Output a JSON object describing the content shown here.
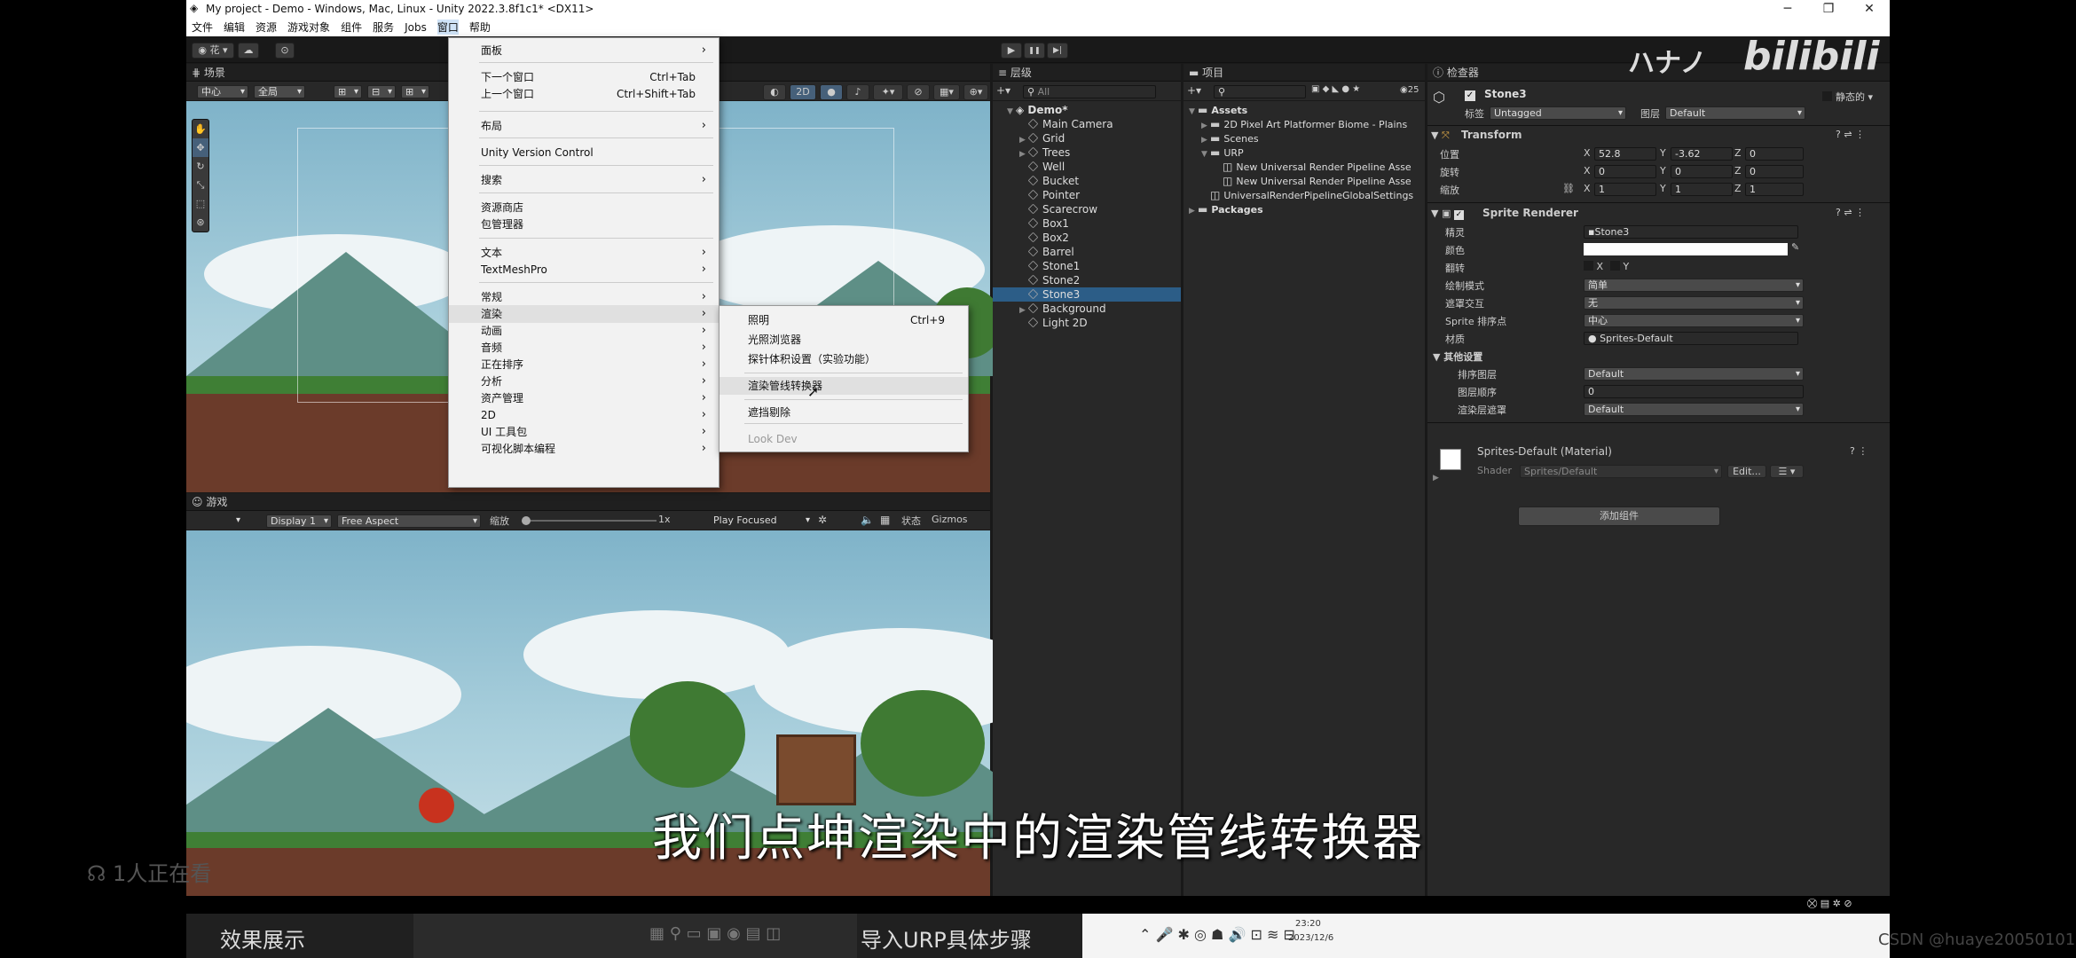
{
  "window": {
    "title": "My project - Demo - Windows, Mac, Linux - Unity 2022.3.8f1c1* <DX11>",
    "min": "─",
    "max": "❐",
    "close": "✕"
  },
  "menubar": [
    "文件",
    "编辑",
    "资源",
    "游戏对象",
    "组件",
    "服务",
    "Jobs",
    "窗口",
    "帮助"
  ],
  "toolbar": {
    "account": "花",
    "play": "▶",
    "pause": "❚❚",
    "step": "▶|"
  },
  "watermark": {
    "brand": "bilibili",
    "text": "ハナノ"
  },
  "window_menu": {
    "items": [
      {
        "label": "面板",
        "shortcut": "",
        "arrow": "›"
      },
      {
        "label": "下一个窗口",
        "shortcut": "Ctrl+Tab",
        "arrow": ""
      },
      {
        "label": "上一个窗口",
        "shortcut": "Ctrl+Shift+Tab",
        "arrow": ""
      },
      {
        "label": "布局",
        "shortcut": "",
        "arrow": "›"
      },
      {
        "label": "Unity Version Control",
        "shortcut": "",
        "arrow": ""
      },
      {
        "label": "搜索",
        "shortcut": "",
        "arrow": "›"
      },
      {
        "label": "资源商店",
        "shortcut": "",
        "arrow": ""
      },
      {
        "label": "包管理器",
        "shortcut": "",
        "arrow": ""
      },
      {
        "label": "文本",
        "shortcut": "",
        "arrow": "›"
      },
      {
        "label": "TextMeshPro",
        "shortcut": "",
        "arrow": "›"
      },
      {
        "label": "常规",
        "shortcut": "",
        "arrow": "›"
      },
      {
        "label": "渲染",
        "shortcut": "",
        "arrow": "›"
      },
      {
        "label": "动画",
        "shortcut": "",
        "arrow": "›"
      },
      {
        "label": "音频",
        "shortcut": "",
        "arrow": "›"
      },
      {
        "label": "正在排序",
        "shortcut": "",
        "arrow": "›"
      },
      {
        "label": "分析",
        "shortcut": "",
        "arrow": "›"
      },
      {
        "label": "资产管理",
        "shortcut": "",
        "arrow": "›"
      },
      {
        "label": "2D",
        "shortcut": "",
        "arrow": "›"
      },
      {
        "label": "UI 工具包",
        "shortcut": "",
        "arrow": "›"
      },
      {
        "label": "可视化脚本编程",
        "shortcut": "",
        "arrow": "›"
      }
    ]
  },
  "render_submenu": {
    "items": [
      {
        "label": "照明",
        "shortcut": "Ctrl+9"
      },
      {
        "label": "光照浏览器",
        "shortcut": ""
      },
      {
        "label": "探针体积设置（实验功能）",
        "shortcut": ""
      },
      {
        "label": "渲染管线转换器",
        "shortcut": ""
      },
      {
        "label": "遮挡剔除",
        "shortcut": ""
      },
      {
        "label": "Look Dev",
        "shortcut": ""
      }
    ]
  },
  "scene": {
    "tab": "场景",
    "pivot": "中心",
    "space": "全局",
    "mode2d": "2D"
  },
  "game": {
    "tab": "游戏",
    "display": "Display 1",
    "aspect": "Free Aspect",
    "scale_label": "缩放",
    "scale_value": "1x",
    "play_focused": "Play Focused",
    "stats": "状态",
    "gizmos": "Gizmos"
  },
  "hierarchy": {
    "tab": "层级",
    "search": "All",
    "root": "Demo*",
    "items": [
      {
        "label": "Main Camera",
        "arrow": ""
      },
      {
        "label": "Grid",
        "arrow": "▶"
      },
      {
        "label": "Trees",
        "arrow": "▶"
      },
      {
        "label": "Well",
        "arrow": ""
      },
      {
        "label": "Bucket",
        "arrow": ""
      },
      {
        "label": "Pointer",
        "arrow": ""
      },
      {
        "label": "Scarecrow",
        "arrow": ""
      },
      {
        "label": "Box1",
        "arrow": ""
      },
      {
        "label": "Box2",
        "arrow": ""
      },
      {
        "label": "Barrel",
        "arrow": ""
      },
      {
        "label": "Stone1",
        "arrow": ""
      },
      {
        "label": "Stone2",
        "arrow": ""
      },
      {
        "label": "Stone3",
        "arrow": ""
      },
      {
        "label": "Background",
        "arrow": "▶"
      },
      {
        "label": "Light 2D",
        "arrow": ""
      }
    ]
  },
  "project": {
    "tab": "项目",
    "count": "25",
    "items": [
      {
        "label": "Assets",
        "indent": 0,
        "arrow": "▼",
        "folder": true
      },
      {
        "label": "2D Pixel Art Platformer Biome - Plains",
        "indent": 1,
        "arrow": "▶",
        "folder": true
      },
      {
        "label": "Scenes",
        "indent": 1,
        "arrow": "▶",
        "folder": true
      },
      {
        "label": "URP",
        "indent": 1,
        "arrow": "▼",
        "folder": true
      },
      {
        "label": "New Universal Render Pipeline Asse",
        "indent": 2,
        "arrow": "",
        "folder": false
      },
      {
        "label": "New Universal Render Pipeline Asse",
        "indent": 2,
        "arrow": "",
        "folder": false
      },
      {
        "label": "UniversalRenderPipelineGlobalSettings",
        "indent": 1,
        "arrow": "",
        "folder": false
      },
      {
        "label": "Packages",
        "indent": 0,
        "arrow": "▶",
        "folder": true
      }
    ]
  },
  "inspector": {
    "tab": "检查器",
    "name": "Stone3",
    "static": "静态的",
    "tag_label": "标签",
    "tag": "Untagged",
    "layer_label": "图层",
    "layer": "Default",
    "transform": "Transform",
    "pos_label": "位置",
    "rot_label": "旋转",
    "scale_label": "缩放",
    "pos": [
      "52.8",
      "-3.62",
      "0"
    ],
    "rot": [
      "0",
      "0",
      "0"
    ],
    "scl": [
      "1",
      "1",
      "1"
    ],
    "sr": "Sprite Renderer",
    "sprite_label": "精灵",
    "sprite": "Stone3",
    "color_label": "颜色",
    "flip_label": "翻转",
    "flip_x": "X",
    "flip_y": "Y",
    "draw_label": "绘制模式",
    "draw": "简单",
    "mask_label": "遮罩交互",
    "mask": "无",
    "sort_label": "Sprite 排序点",
    "sort": "中心",
    "mat_label": "材质",
    "mat": "Sprites-Default",
    "other": "其他设置",
    "slayer_label": "排序图层",
    "slayer": "Default",
    "order_label": "图层顺序",
    "order": "0",
    "rlayer_label": "渲染层遮罩",
    "rlayer": "Default",
    "material": "Sprites-Default (Material)",
    "shader_label": "Shader",
    "shader": "Sprites/Default",
    "edit": "Edit...",
    "add": "添加组件"
  },
  "overlay": {
    "viewers": "1人正在看",
    "subtitle": "我们点坤渲染中的渲染管线转换器",
    "effect": "效果展示",
    "urp_steps": "导入URP具体步骤",
    "time": "23:20",
    "date": "2023/12/6",
    "csdn": "CSDN @huaye20050101"
  }
}
